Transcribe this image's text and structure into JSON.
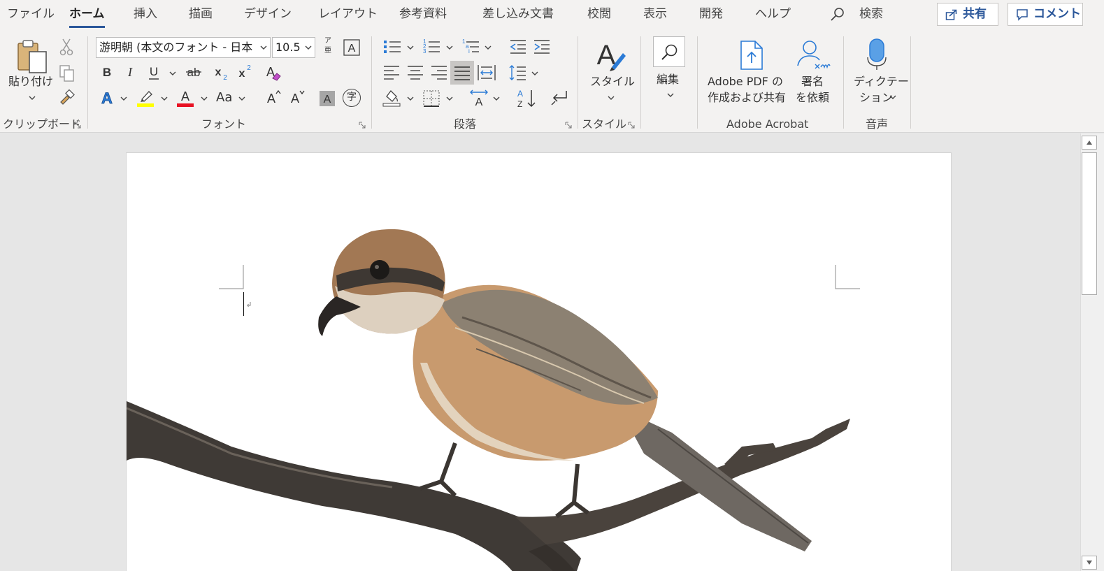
{
  "tabs": [
    "ファイル",
    "ホーム",
    "挿入",
    "描画",
    "デザイン",
    "レイアウト",
    "参考資料",
    "差し込み文書",
    "校閲",
    "表示",
    "開発",
    "ヘルプ"
  ],
  "active_tab": "ホーム",
  "search_label": "検索",
  "share_label": "共有",
  "comment_label": "コメント",
  "clipboard": {
    "paste_label": "貼り付け",
    "group_label": "クリップボード"
  },
  "font": {
    "family": "游明朝 (本文のフォント - 日本",
    "size": "10.5",
    "group_label": "フォント",
    "case_label": "Aa",
    "phonetic_top": "ア",
    "phonetic_bottom": "亜",
    "enclose_char": "字"
  },
  "paragraph": {
    "group_label": "段落"
  },
  "styles": {
    "button_label": "スタイル",
    "group_label": "スタイル"
  },
  "editing": {
    "button_label": "編集"
  },
  "acrobat": {
    "create_line1": "Adobe PDF の",
    "create_line2": "作成および共有",
    "sign_line1": "署名",
    "sign_line2": "を依頼",
    "group_label": "Adobe Acrobat"
  },
  "voice": {
    "dictate_line1": "ディクテー",
    "dictate_line2": "ション",
    "group_label": "音声"
  },
  "colors": {
    "accent": "#2b579a",
    "highlight": "#ffff00",
    "font_color": "#e81123",
    "ribbon_bg": "#f3f2f1",
    "workspace_bg": "#e6e6e6"
  },
  "icons": [
    "paste-icon",
    "cut-icon",
    "copy-icon",
    "format-painter-icon",
    "bold-icon",
    "italic-icon",
    "underline-icon",
    "strikethrough-icon",
    "subscript-icon",
    "superscript-icon",
    "clear-formatting-icon",
    "text-effects-icon",
    "highlight-icon",
    "font-color-icon",
    "change-case-icon",
    "grow-font-icon",
    "shrink-font-icon",
    "char-shading-icon",
    "enclose-char-icon",
    "bullets-icon",
    "numbering-icon",
    "multilevel-list-icon",
    "decrease-indent-icon",
    "increase-indent-icon",
    "align-left-icon",
    "center-icon",
    "align-right-icon",
    "justify-icon",
    "distributed-icon",
    "line-spacing-icon",
    "shading-icon",
    "borders-icon",
    "asian-layout-icon",
    "sort-icon",
    "show-marks-icon",
    "styles-icon",
    "find-icon",
    "create-pdf-icon",
    "request-signature-icon",
    "microphone-icon"
  ]
}
